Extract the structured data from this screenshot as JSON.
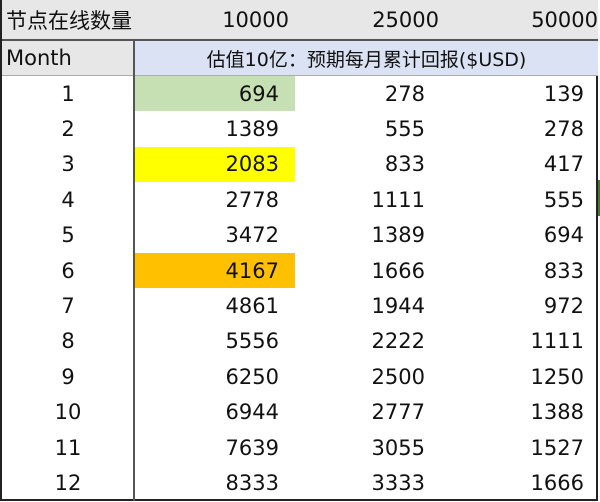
{
  "header": {
    "label": "节点在线数量",
    "node_counts": [
      "10000",
      "25000",
      "50000"
    ]
  },
  "subheader": {
    "month_label": "Month",
    "merged_title": "估值10亿：预期每月累计回报($USD)"
  },
  "colors": {
    "header_gray": "#e7e7e7",
    "header_blue": "#dae2f3",
    "highlight_green": "#c6e0b4",
    "highlight_yellow": "#ffff00",
    "highlight_orange": "#ffc000"
  },
  "rows": [
    {
      "month": "1",
      "v10000": "694",
      "v25000": "278",
      "v50000": "139",
      "highlight": "green"
    },
    {
      "month": "2",
      "v10000": "1389",
      "v25000": "555",
      "v50000": "278",
      "highlight": ""
    },
    {
      "month": "3",
      "v10000": "2083",
      "v25000": "833",
      "v50000": "417",
      "highlight": "yellow"
    },
    {
      "month": "4",
      "v10000": "2778",
      "v25000": "1111",
      "v50000": "555",
      "highlight": ""
    },
    {
      "month": "5",
      "v10000": "3472",
      "v25000": "1389",
      "v50000": "694",
      "highlight": ""
    },
    {
      "month": "6",
      "v10000": "4167",
      "v25000": "1666",
      "v50000": "833",
      "highlight": "orange"
    },
    {
      "month": "7",
      "v10000": "4861",
      "v25000": "1944",
      "v50000": "972",
      "highlight": ""
    },
    {
      "month": "8",
      "v10000": "5556",
      "v25000": "2222",
      "v50000": "1111",
      "highlight": ""
    },
    {
      "month": "9",
      "v10000": "6250",
      "v25000": "2500",
      "v50000": "1250",
      "highlight": ""
    },
    {
      "month": "10",
      "v10000": "6944",
      "v25000": "2777",
      "v50000": "1388",
      "highlight": ""
    },
    {
      "month": "11",
      "v10000": "7639",
      "v25000": "3055",
      "v50000": "1527",
      "highlight": ""
    },
    {
      "month": "12",
      "v10000": "8333",
      "v25000": "3333",
      "v50000": "1666",
      "highlight": ""
    }
  ]
}
